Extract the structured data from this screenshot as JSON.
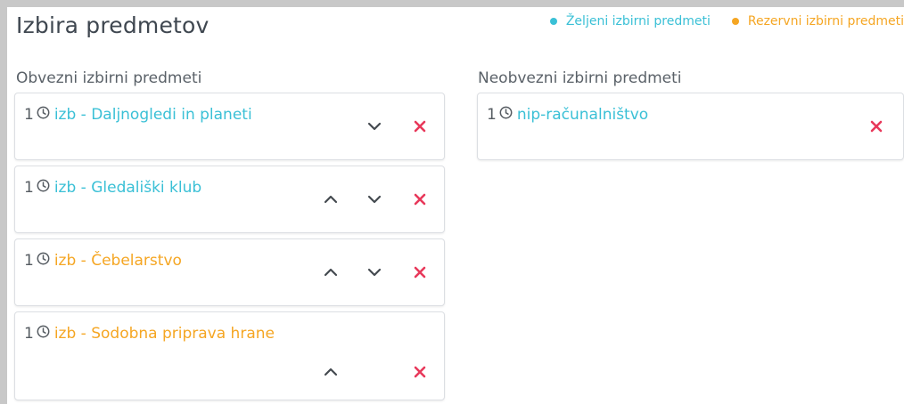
{
  "page": {
    "title": "Izbira predmetov"
  },
  "legend": [
    {
      "label": "Željeni izbirni predmeti",
      "color": "#3ac0d6"
    },
    {
      "label": "Rezervni izbirni predmeti",
      "color": "#f5a623"
    }
  ],
  "obvezni": {
    "heading": "Obvezni izbirni predmeti",
    "items": [
      {
        "hours": "1",
        "name": "izb - Daljnogledi in planeti",
        "type": "preferred"
      },
      {
        "hours": "1",
        "name": "izb - Gledališki klub",
        "type": "preferred"
      },
      {
        "hours": "1",
        "name": "izb - Čebelarstvo",
        "type": "reserve"
      },
      {
        "hours": "1",
        "name": "izb - Sodobna priprava hrane",
        "type": "reserve"
      }
    ]
  },
  "neobvezni": {
    "heading": "Neobvezni izbirni predmeti",
    "items": [
      {
        "hours": "1",
        "name": "nip-računalništvo",
        "type": "preferred"
      }
    ]
  },
  "colors": {
    "preferred": "#3ac0d6",
    "reserve": "#f5a623",
    "remove": "#e8385a",
    "chevron": "#444a50"
  },
  "icons": {
    "hours": "clock-icon",
    "move_up": "chevron-up-icon",
    "move_down": "chevron-down-icon",
    "remove": "close-icon"
  }
}
